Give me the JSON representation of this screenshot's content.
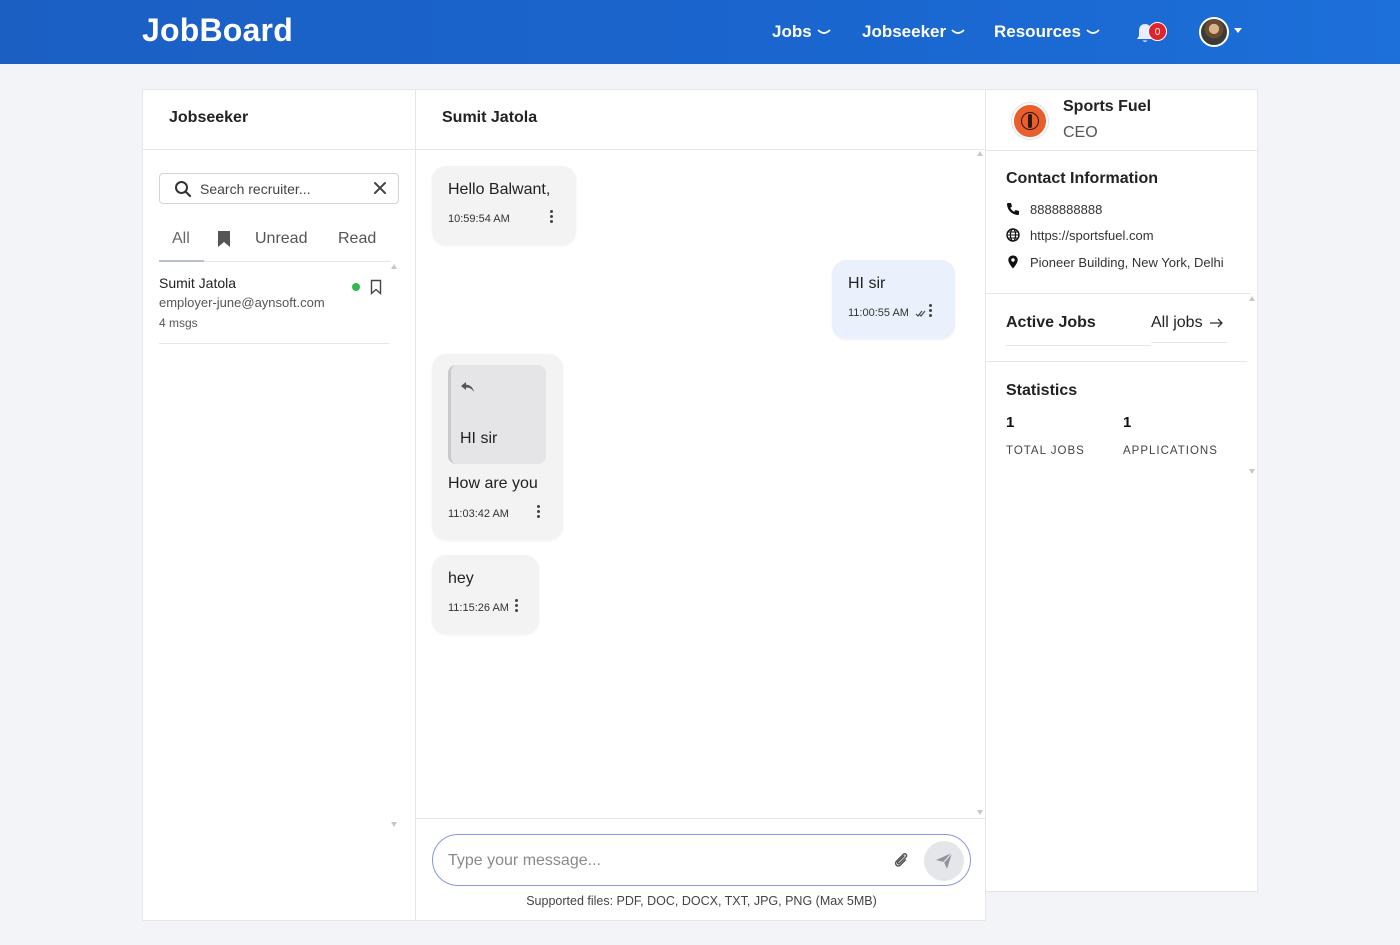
{
  "header": {
    "logo": "JobBoard",
    "nav": [
      {
        "label": "Jobs"
      },
      {
        "label": "Jobseeker"
      },
      {
        "label": "Resources"
      }
    ],
    "notification_count": "0"
  },
  "left_panel": {
    "title": "Jobseeker",
    "search_placeholder": "Search recruiter...",
    "tabs": {
      "all": "All",
      "unread": "Unread",
      "read": "Read"
    },
    "contacts": [
      {
        "name": "Sumit Jatola",
        "email": "employer-june@aynsoft.com",
        "count": "4 msgs",
        "status_color": "#31b94d"
      }
    ]
  },
  "chat": {
    "title": "Sumit Jatola",
    "messages": [
      {
        "text": "Hello Balwant,",
        "time": "10:59:54 AM",
        "direction": "incoming"
      },
      {
        "text": "HI sir",
        "time": "11:00:55 AM",
        "direction": "outgoing"
      },
      {
        "reply_to": "HI sir",
        "text": "How are you",
        "time": "11:03:42 AM",
        "direction": "incoming"
      },
      {
        "text": "hey",
        "time": "11:15:26 AM",
        "direction": "incoming"
      }
    ],
    "input_placeholder": "Type your message...",
    "supported_files": "Supported files: PDF, DOC, DOCX, TXT, JPG, PNG (Max 5MB)"
  },
  "right_panel": {
    "company": "Sports Fuel",
    "role": "CEO",
    "contact_title": "Contact Information",
    "phone": "8888888888",
    "website": "https://sportsfuel.com",
    "address": "Pioneer Building, New York, Delhi",
    "active_jobs_title": "Active Jobs",
    "all_jobs_label": "All jobs",
    "statistics_title": "Statistics",
    "stats": [
      {
        "value": "1",
        "label": "TOTAL JOBS"
      },
      {
        "value": "1",
        "label": "APPLICATIONS"
      }
    ]
  },
  "colors": {
    "brand": "#1b5fc3",
    "outgoing_bubble": "#eaf1fd",
    "incoming_bubble": "#f3f3f4",
    "badge": "#e0242c"
  }
}
